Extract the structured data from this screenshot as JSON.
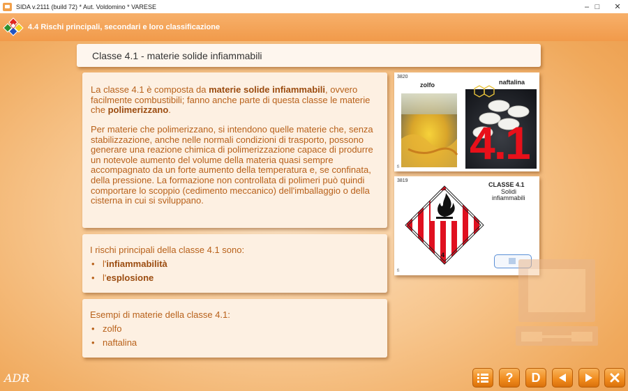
{
  "window": {
    "title": "SIDA v.2111 (build 72) * Aut. Voldomino * VARESE",
    "controls": [
      "minimize-icon",
      "maximize-icon",
      "close-icon"
    ]
  },
  "header": {
    "section_title": "4.4 Rischi principali, secondari e loro classificazione"
  },
  "title_box": {
    "text": "Classe 4.1 - materie solide infiammabili"
  },
  "main_box": {
    "p1": {
      "t1": "La classe 4.1 è composta da ",
      "b1": "materie solide infiammabili",
      "t2": ", ovvero facilmente combustibili; fanno anche parte di questa classe le materie che ",
      "b2": "polimerizzano",
      "t3": "."
    },
    "p2": "Per materie che polimerizzano, si intendono quelle materie che, senza stabilizzazione, anche nelle normali condizioni di trasporto, possono generare una reazione chimica di polimerizzazione capace di produrre un notevole aumento del volume della materia quasi sempre accompagnato da un forte aumento della temperatura e, se confinata, della pressione. La formazione non controllata di polimeri può quindi comportare lo scoppio (cedimento meccanico) dell'imballaggio o della cisterna in cui si sviluppano."
  },
  "risks_box": {
    "heading": "I rischi principali della classe 4.1 sono:",
    "items": [
      {
        "bullet": "•",
        "prefix": "l'",
        "bold": "infiammabilità"
      },
      {
        "bullet": "•",
        "prefix": "l'",
        "bold": "esplosione"
      }
    ]
  },
  "examples_box": {
    "heading": "Esempi di materie della classe 4.1:",
    "items": [
      {
        "bullet": "•",
        "text": "zolfo"
      },
      {
        "bullet": "•",
        "text": "naftalina"
      }
    ]
  },
  "card1": {
    "number": "3820",
    "label_left": "zolfo",
    "label_right": "naftalina",
    "big_label": "4.1",
    "small_mark": "fi"
  },
  "card2": {
    "number": "3819",
    "class_label": "CLASSE 4.1",
    "subtitle_line1": "Solidi",
    "subtitle_line2": "infiammabili",
    "placard_number": "4",
    "small_mark": "fi"
  },
  "footer": {
    "adr_label": "ADR",
    "buttons": [
      {
        "name": "menu-button",
        "icon": "list-icon"
      },
      {
        "name": "help-button",
        "icon": "question-icon",
        "label": "?"
      },
      {
        "name": "d-button",
        "label": "D"
      },
      {
        "name": "back-button",
        "icon": "arrow-left-icon"
      },
      {
        "name": "forward-button",
        "icon": "arrow-right-icon"
      },
      {
        "name": "exit-button",
        "icon": "x-icon"
      }
    ]
  },
  "colors": {
    "accent_orange": "#f19a4a",
    "text_brown": "#b8611a",
    "bold_brown": "#9b4c10",
    "placard_red": "#e01020",
    "big_label_red": "#e8101a"
  }
}
